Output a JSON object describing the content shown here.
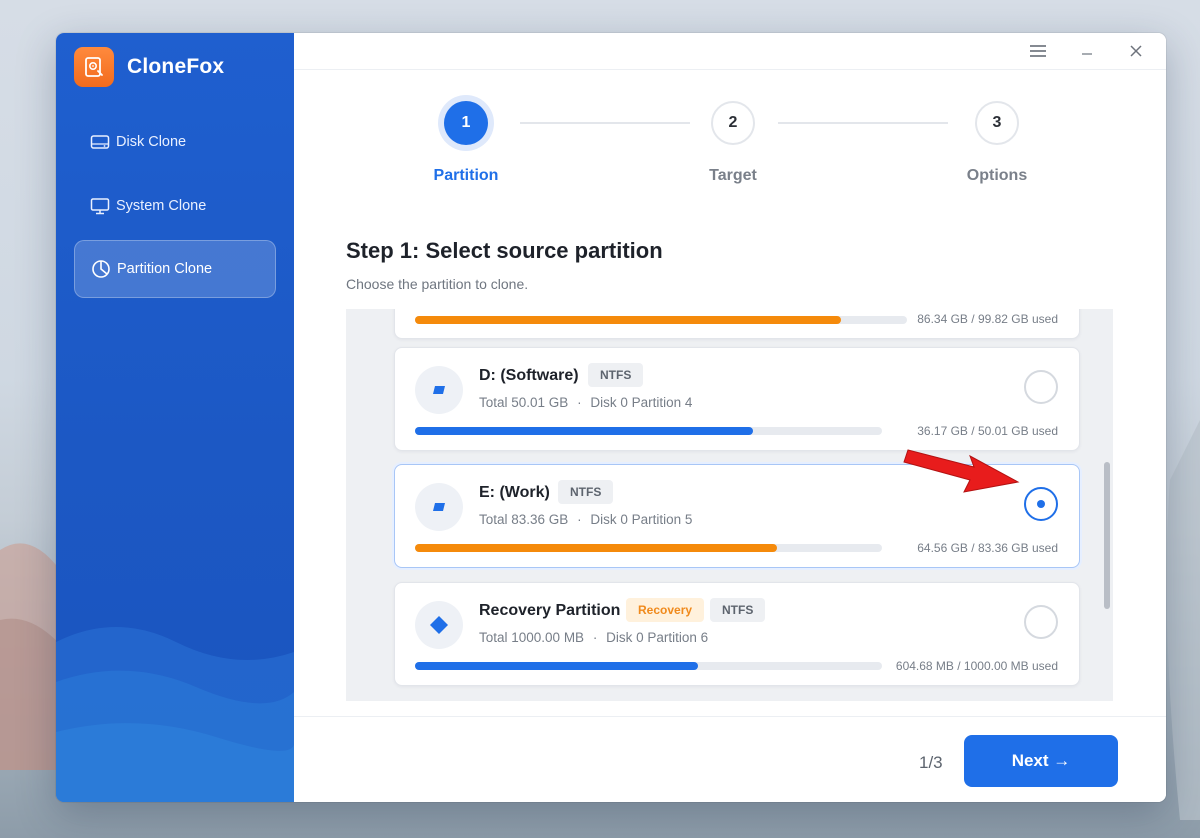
{
  "app": {
    "name": "CloneFox"
  },
  "sidebar": {
    "items": [
      {
        "label": "Disk Clone",
        "icon": "hard-drive-icon",
        "active": false
      },
      {
        "label": "System Clone",
        "icon": "monitor-icon",
        "active": false
      },
      {
        "label": "Partition Clone",
        "icon": "pie-chart-icon",
        "active": true
      }
    ]
  },
  "window_controls": {
    "menu": "menu-icon",
    "minimize": "minimize-icon",
    "close": "close-icon"
  },
  "stepper": {
    "steps": [
      {
        "number": "1",
        "label": "Partition",
        "state": "current"
      },
      {
        "number": "2",
        "label": "Target",
        "state": "pending"
      },
      {
        "number": "3",
        "label": "Options",
        "state": "pending"
      }
    ]
  },
  "content": {
    "title": "Step 1: Select source partition",
    "subtitle": "Choose the partition to clone."
  },
  "partitions": [
    {
      "name": "",
      "usage": "86.34 GB / 99.82 GB used",
      "used_fraction": 0.865,
      "bar_color": "#f58a0b",
      "partial": true
    },
    {
      "name": "D: (Software)",
      "badges": [
        "NTFS"
      ],
      "total": "Total 50.01 GB",
      "location": "Disk 0 Partition 4",
      "usage": "36.17 GB / 50.01 GB used",
      "used_fraction": 0.723,
      "bar_color": "#1f6fe8",
      "selected": false,
      "icon": "drive-icon"
    },
    {
      "name": "E: (Work)",
      "badges": [
        "NTFS"
      ],
      "total": "Total 83.36 GB",
      "location": "Disk 0 Partition 5",
      "usage": "64.56 GB / 83.36 GB used",
      "used_fraction": 0.775,
      "bar_color": "#f58a0b",
      "selected": true,
      "icon": "drive-icon"
    },
    {
      "name": "Recovery Partition",
      "badges": [
        "Recovery",
        "NTFS"
      ],
      "total": "Total 1000.00 MB",
      "location": "Disk 0 Partition 6",
      "usage": "604.68 MB / 1000.00 MB used",
      "used_fraction": 0.605,
      "bar_color": "#1f6fe8",
      "selected": false,
      "icon": "recovery-diamond-icon"
    }
  ],
  "meta_separator": "·",
  "footer": {
    "page": "1/3",
    "next_label": "Next →"
  },
  "colors": {
    "accent": "#1f6fe8",
    "sidebar": "#1c58c4",
    "warning": "#f58a0b",
    "annotation_arrow": "#e81c1c"
  }
}
